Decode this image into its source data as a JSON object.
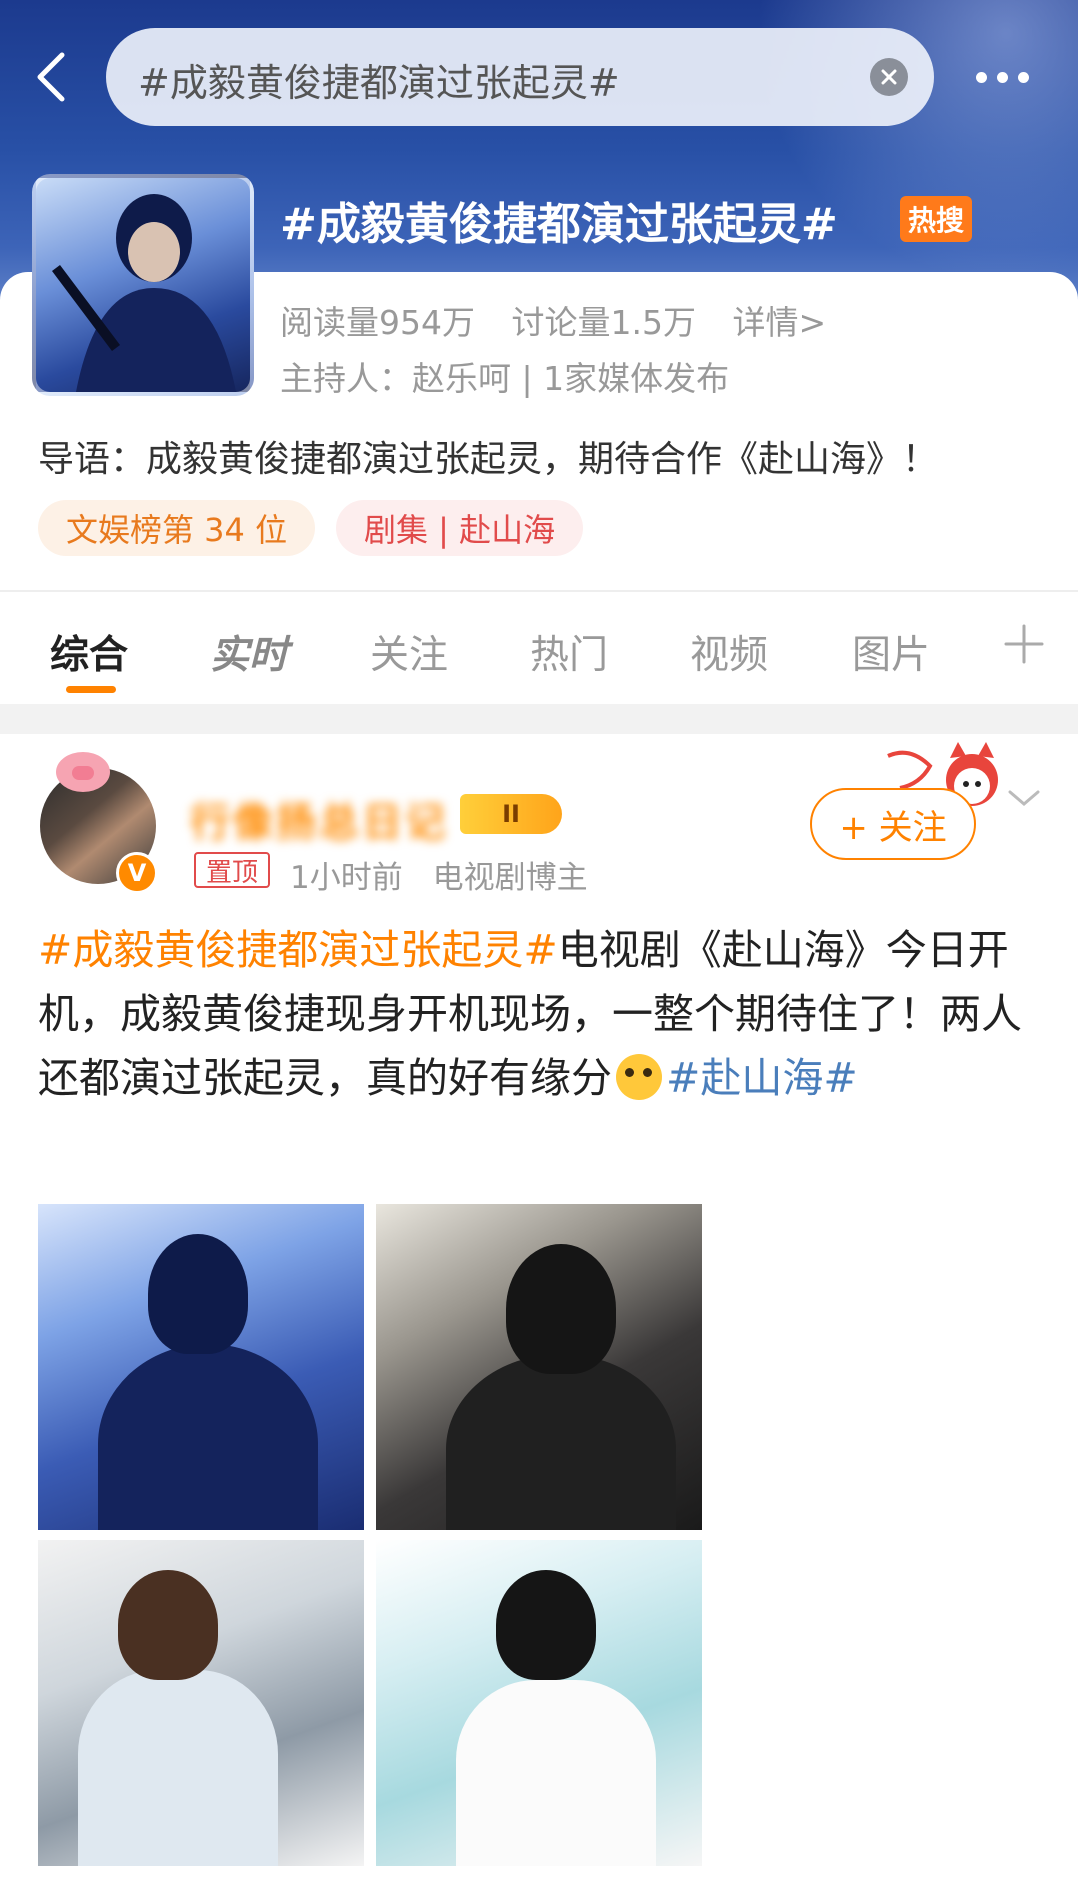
{
  "search": {
    "query": "#成毅黄俊捷都演过张起灵#"
  },
  "topic": {
    "title": "#成毅黄俊捷都演过张起灵#",
    "hot_badge": "热搜",
    "reads": "阅读量954万",
    "discussions": "讨论量1.5万",
    "details_link": "详情>",
    "host": "主持人：赵乐呵 | 1家媒体发布",
    "intro": "导语：成毅黄俊捷都演过张起灵，期待合作《赴山海》！",
    "tags": [
      "文娱榜第 34 位",
      "剧集 | 赴山海"
    ]
  },
  "tabs": [
    {
      "label": "综合",
      "active": true
    },
    {
      "label": "实时",
      "active": false
    },
    {
      "label": "关注",
      "active": false
    },
    {
      "label": "热门",
      "active": false
    },
    {
      "label": "视频",
      "active": false
    },
    {
      "label": "图片",
      "active": false
    }
  ],
  "post": {
    "username": "行像扬总日记",
    "level": "II",
    "pinned": "置顶",
    "time": "1小时前",
    "author_type": "电视剧博主",
    "follow_label": "+ 关注",
    "hashtag_main": "#成毅黄俊捷都演过张起灵#",
    "text_main": "电视剧《赴山海》今日开机，成毅黄俊捷现身开机现场，一整个期待住了！两人还都演过张起灵，真的好有缘分",
    "hashtag_end": "#赴山海#",
    "image_count": 4
  },
  "colors": {
    "accent": "#ff8200",
    "hashtag_blue": "#4a7ebb",
    "header_blue": "#2850a6"
  }
}
